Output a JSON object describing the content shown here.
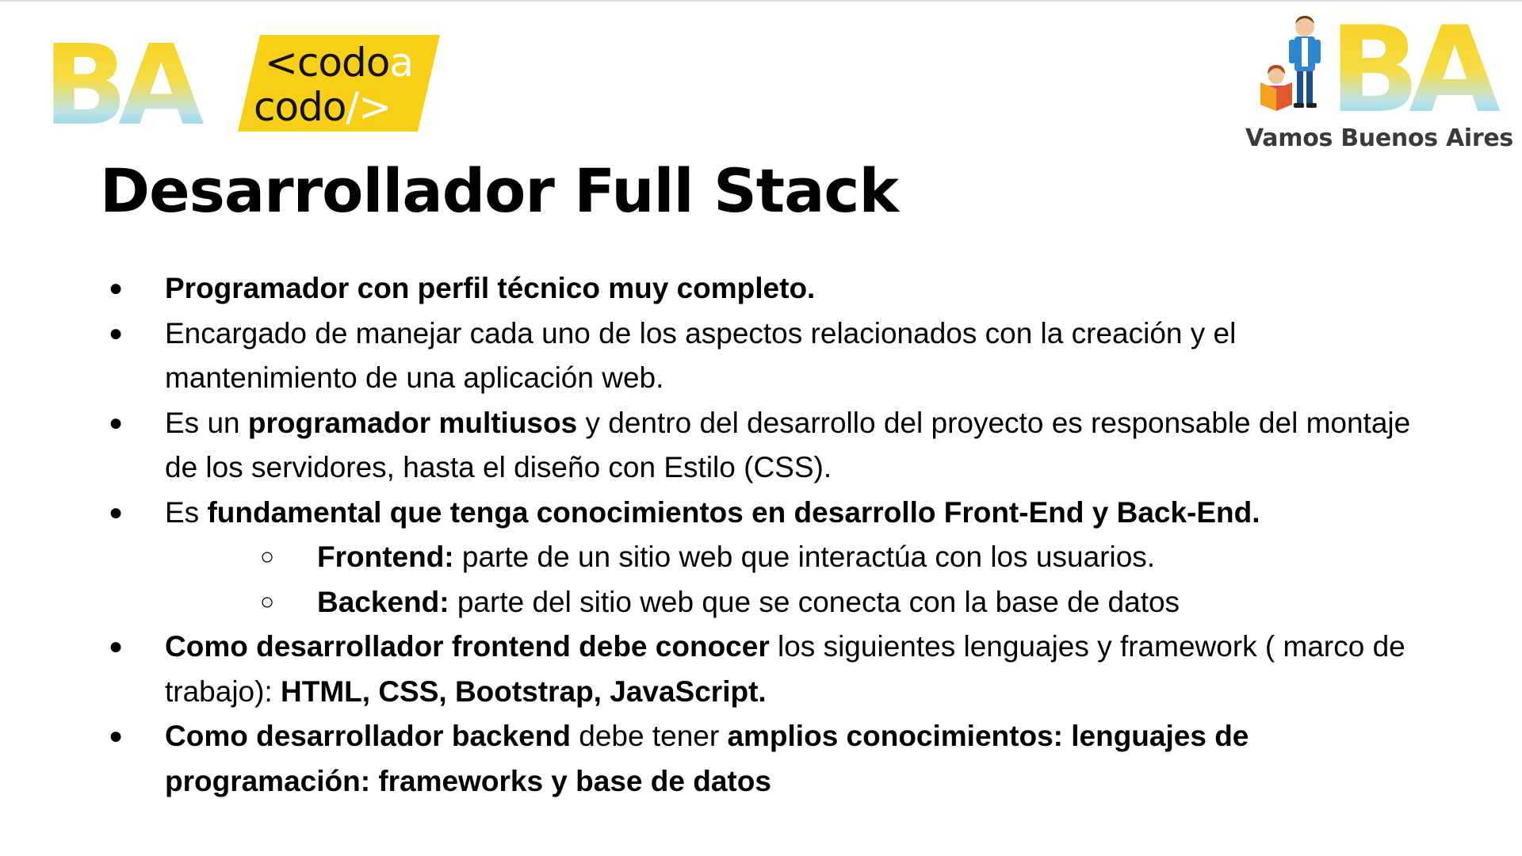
{
  "logos": {
    "ba_text": "BA",
    "codo_line1": "<codo",
    "codo_line1_accent": "a",
    "codo_line2": "codo",
    "codo_line2_accent": "/>",
    "vamos_logo_text": "BA",
    "vamos_caption": "Vamos Buenos Aires"
  },
  "colors": {
    "brand_yellow": "#F7CF17",
    "brand_blue": "#5BC4F0",
    "codo_text": "#000000",
    "codo_accent": "#ffffff"
  },
  "slide": {
    "title": "Desarrollador Full Stack",
    "items": [
      {
        "id": "b1",
        "level": 1,
        "bullet": "●",
        "parts": [
          {
            "text": "Programador con perfil técnico muy completo.",
            "bold": true
          }
        ]
      },
      {
        "id": "b2",
        "level": 1,
        "bullet": "●",
        "parts": [
          {
            "text": "Encargado de manejar cada uno de los aspectos relacionados con la creación y el mantenimiento de una aplicación web.",
            "bold": false
          }
        ]
      },
      {
        "id": "b3",
        "level": 1,
        "bullet": "●",
        "parts": [
          {
            "text": "Es un ",
            "bold": false
          },
          {
            "text": "programador multiusos",
            "bold": true
          },
          {
            "text": " y dentro del desarrollo del proyecto es responsable del montaje de los servidores, hasta el diseño con Estilo (CSS).",
            "bold": false
          }
        ]
      },
      {
        "id": "b4",
        "level": 1,
        "bullet": "●",
        "parts": [
          {
            "text": "Es ",
            "bold": false
          },
          {
            "text": "fundamental que tenga conocimientos en desarrollo Front-End y Back-End.",
            "bold": true
          }
        ]
      },
      {
        "id": "b4a",
        "level": 2,
        "bullet": "○",
        "parts": [
          {
            "text": "Frontend:",
            "bold": true
          },
          {
            "text": " parte de un sitio web que interactúa con los usuarios.",
            "bold": false
          }
        ]
      },
      {
        "id": "b4b",
        "level": 2,
        "bullet": "○",
        "parts": [
          {
            "text": "Backend:",
            "bold": true
          },
          {
            "text": " parte del sitio web que se conecta con la base de datos",
            "bold": false
          }
        ]
      },
      {
        "id": "b5",
        "level": 1,
        "bullet": "●",
        "parts": [
          {
            "text": "Como desarrollador frontend debe conocer",
            "bold": true
          },
          {
            "text": " los siguientes lenguajes y framework ( marco de trabajo): ",
            "bold": false
          },
          {
            "text": "HTML, CSS, Bootstrap, JavaScript.",
            "bold": true
          }
        ]
      },
      {
        "id": "b6",
        "level": 1,
        "bullet": "●",
        "parts": [
          {
            "text": "Como desarrollador backend",
            "bold": true
          },
          {
            "text": " debe tener ",
            "bold": false
          },
          {
            "text": "amplios conocimientos: lenguajes de programación: frameworks y base de datos",
            "bold": true
          }
        ]
      }
    ]
  }
}
